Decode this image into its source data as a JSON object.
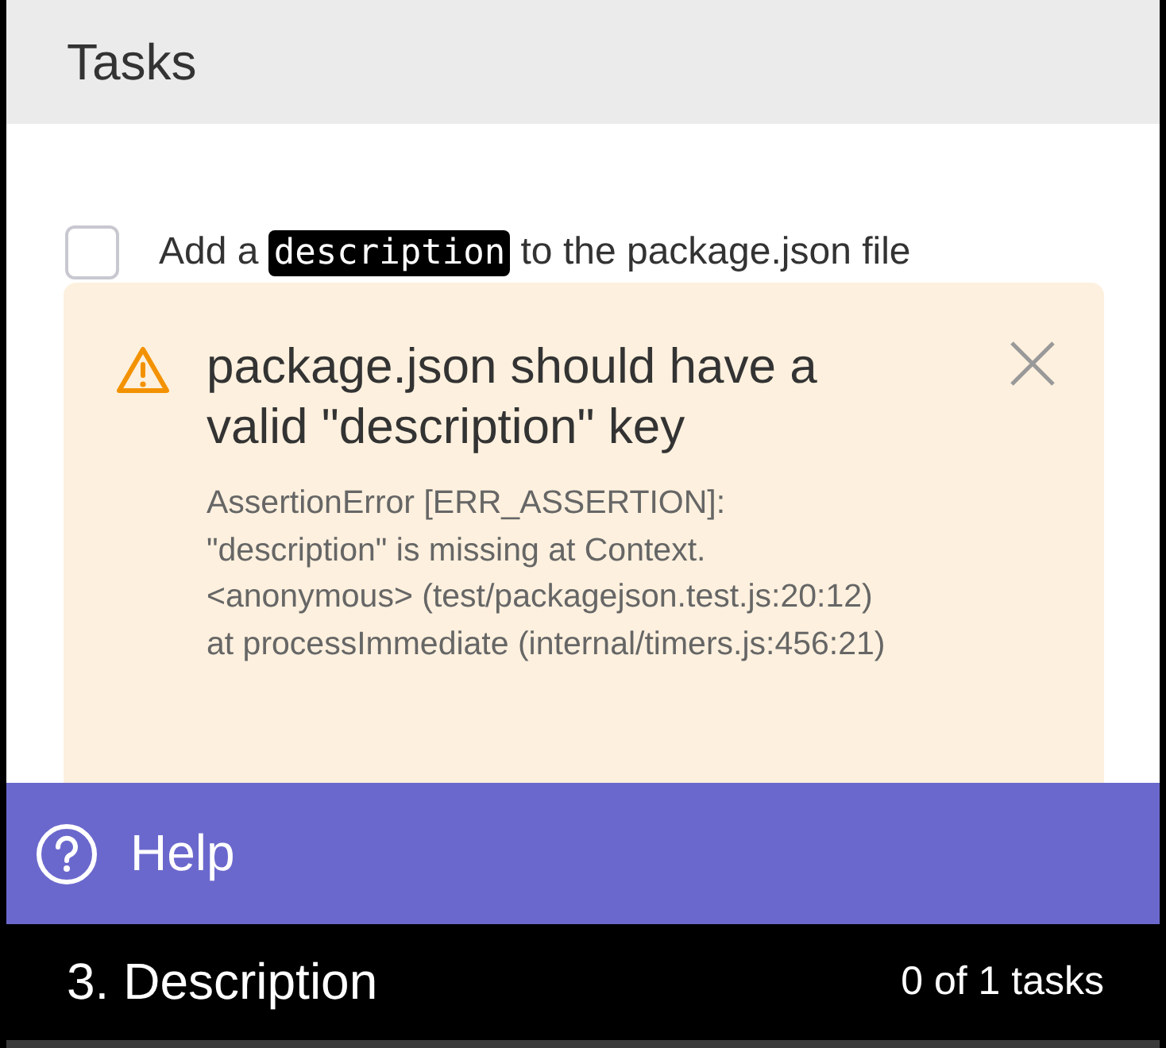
{
  "header": {
    "title": "Tasks"
  },
  "tasks": [
    {
      "checked": false,
      "parts": [
        {
          "kind": "text",
          "text": "Add a "
        },
        {
          "kind": "code",
          "text": "description"
        },
        {
          "kind": "text",
          "text": " to the package.json file"
        }
      ]
    }
  ],
  "error": {
    "title": "package.json should have a valid \"description\" key",
    "message": "AssertionError [ERR_ASSERTION]: \"description\" is missing at Context.<anonymous> (test/packagejson.test.js:20:12) at processImmediate (internal/timers.js:456:21)"
  },
  "help": {
    "label": "Help"
  },
  "footer": {
    "title": "3. Description",
    "progress": "0 of 1 tasks"
  }
}
